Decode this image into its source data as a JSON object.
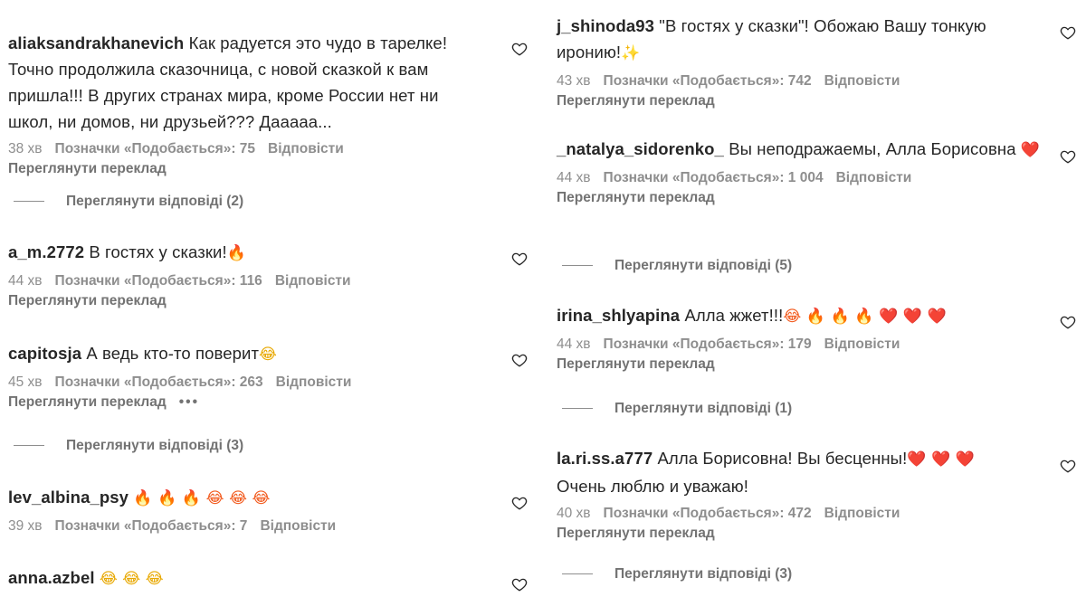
{
  "left": [
    {
      "username": "aliaksandrakhanevich",
      "text": "Как радуется это чудо в тарелке! Точно продолжила сказочница, с новой сказкой к вам пришла!!! В других странах мира, кроме России нет ни школ, ни домов, ни друзьей??? Дааааа...",
      "time": "38 хв",
      "likes": "Позначки «Подобається»: 75",
      "reply": "Відповісти",
      "translate": "Переглянути переклад",
      "view_replies": "Переглянути відповіді (2)"
    },
    {
      "username": "a_m.2772",
      "text": "В гостях у сказки!",
      "emoji": "🔥",
      "time": "44 хв",
      "likes": "Позначки «Подобається»: 116",
      "reply": "Відповісти",
      "translate": "Переглянути переклад"
    },
    {
      "username": "capitosja",
      "text": "А ведь кто-то поверит",
      "emoji": "😂",
      "time": "45 хв",
      "likes": "Позначки «Подобається»: 263",
      "reply": "Відповісти",
      "translate": "Переглянути переклад",
      "more": "•••",
      "view_replies": "Переглянути відповіді (3)"
    },
    {
      "username": "lev_albina_psy",
      "emoji": "🔥 🔥 🔥 😂 😂 😂",
      "time": "39 хв",
      "likes": "Позначки «Подобається»: 7",
      "reply": "Відповісти"
    },
    {
      "username": "anna.azbel",
      "emoji": "😂 😂 😂"
    }
  ],
  "right": [
    {
      "username": "j_shinoda93",
      "text": "\"В гостях у сказки\"! Обожаю Вашу тонкую иронию!",
      "emoji": "✨",
      "time": "43 хв",
      "likes": "Позначки «Подобається»: 742",
      "reply": "Відповісти",
      "translate": "Переглянути переклад"
    },
    {
      "username": "_natalya_sidorenko_",
      "text": "Вы неподражаемы, Алла Борисовна",
      "emoji": "❤️",
      "time": "44 хв",
      "likes": "Позначки «Подобається»: 1 004",
      "reply": "Відповісти",
      "translate": "Переглянути переклад",
      "view_replies": "Переглянути відповіді (5)"
    },
    {
      "username": "irina_shlyapina",
      "text": "Алла жжет!!!",
      "emoji": "😂 🔥 🔥 🔥 ❤️ ❤️ ❤️",
      "time": "44 хв",
      "likes": "Позначки «Подобається»: 179",
      "reply": "Відповісти",
      "translate": "Переглянути переклад",
      "view_replies": "Переглянути відповіді (1)"
    },
    {
      "username": "la.ri.ss.a777",
      "text": "Алла Борисовна! Вы бесценны!",
      "emoji": "❤️ ❤️ ❤️",
      "text2": "Очень люблю и уважаю!",
      "time": "40 хв",
      "likes": "Позначки «Подобається»: 472",
      "reply": "Відповісти",
      "translate": "Переглянути переклад",
      "view_replies": "Переглянути відповіді (3)"
    }
  ],
  "icons": {
    "like": "heart-outline-icon"
  },
  "colors": {
    "text": "#262626",
    "meta": "#8e8e8e"
  }
}
